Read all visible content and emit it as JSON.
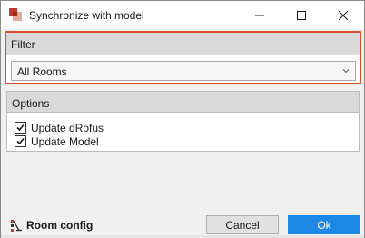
{
  "window": {
    "title": "Synchronize with model",
    "controls": [
      "minimize",
      "maximize",
      "close"
    ]
  },
  "filter": {
    "label": "Filter",
    "selected": "All Rooms"
  },
  "options": {
    "label": "Options",
    "items": [
      {
        "label": "Update dRofus",
        "checked": true
      },
      {
        "label": "Update Model",
        "checked": true
      }
    ]
  },
  "footer": {
    "room_config_label": "Room config",
    "cancel_label": "Cancel",
    "ok_label": "Ok"
  },
  "colors": {
    "highlight": "#d7532b",
    "ok_button": "#1e88e5",
    "app_icon": "#c0392b"
  },
  "icons": {
    "app": "drofus-app-icon",
    "room_config": "room-config-icon",
    "dropdown": "chevron-down-icon"
  }
}
